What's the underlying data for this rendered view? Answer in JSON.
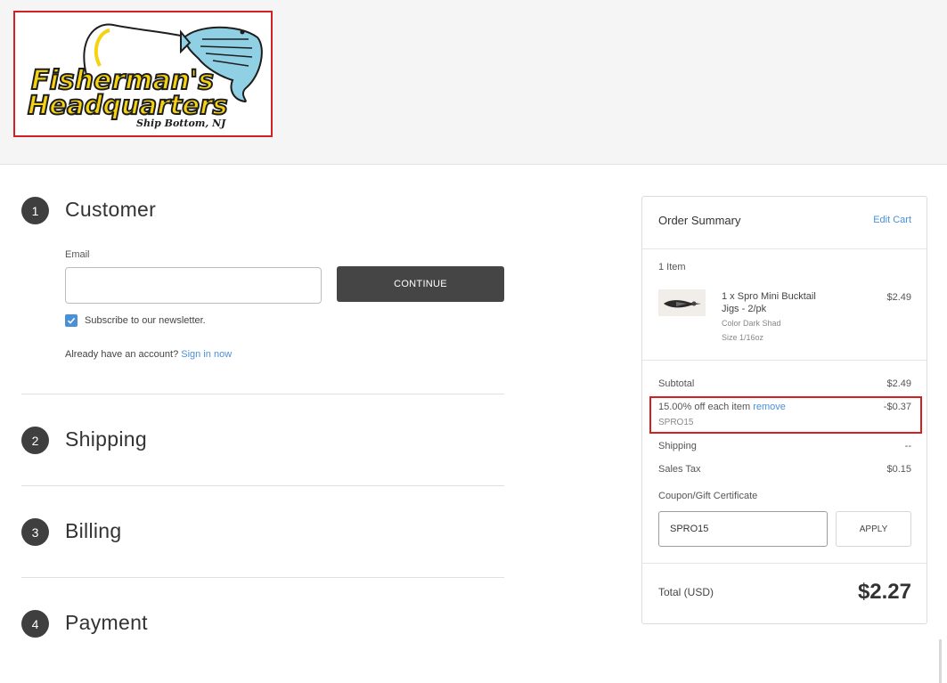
{
  "logo": {
    "text_line1": "Fisherman's",
    "text_line2": "Headquarters",
    "subtext": "Ship Bottom, NJ",
    "colors": {
      "yellow": "#f5d311",
      "dark": "#1e1e1e",
      "fish": "#8fd0e4",
      "frame": "#d42020"
    }
  },
  "steps": [
    {
      "number": "1",
      "title": "Customer"
    },
    {
      "number": "2",
      "title": "Shipping"
    },
    {
      "number": "3",
      "title": "Billing"
    },
    {
      "number": "4",
      "title": "Payment"
    }
  ],
  "customer": {
    "email_label": "Email",
    "email_value": "",
    "continue_label": "CONTINUE",
    "subscribe_label": "Subscribe to our newsletter.",
    "subscribe_checked": true,
    "account_prompt": "Already have an account?",
    "sign_in_link": "Sign in now"
  },
  "summary": {
    "title": "Order Summary",
    "edit_cart": "Edit Cart",
    "item_count": "1 Item",
    "item": {
      "name_line1": "1 x Spro Mini Bucktail",
      "name_line2": "Jigs - 2/pk",
      "color": "Color Dark Shad",
      "size": "Size 1/16oz",
      "price": "$2.49"
    },
    "subtotal_label": "Subtotal",
    "subtotal_value": "$2.49",
    "discount_label": "15.00% off each item",
    "discount_remove": "remove",
    "discount_code": "SPRO15",
    "discount_value": "-$0.37",
    "shipping_label": "Shipping",
    "shipping_value": "--",
    "tax_label": "Sales Tax",
    "tax_value": "$0.15",
    "coupon_label": "Coupon/Gift Certificate",
    "coupon_value": "SPRO15",
    "apply_label": "APPLY",
    "total_label": "Total (USD)",
    "total_value": "$2.27"
  },
  "colors": {
    "accent_link": "#4a90d9",
    "button_dark": "#454545",
    "highlight_red": "#d42020"
  }
}
